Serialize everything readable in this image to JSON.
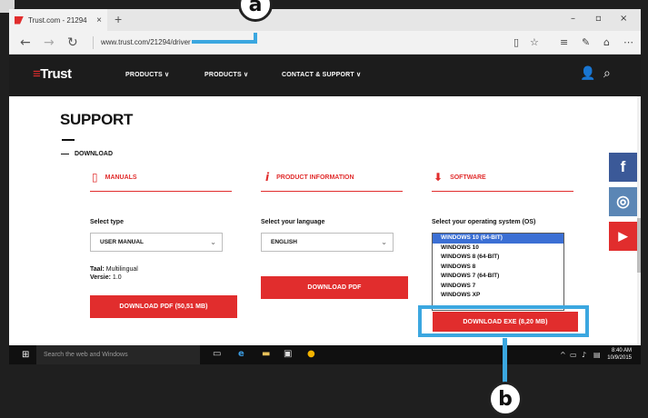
{
  "browser": {
    "tab_title": "Trust.com - 21294",
    "tab_close": "×",
    "new_tab": "+",
    "url": "www.trust.com/21294/driver",
    "win_min": "–",
    "win_max": "▫",
    "win_close": "×"
  },
  "site": {
    "logo_mark": "≡",
    "logo_text": "Trust",
    "nav": [
      "PRODUCTS ∨",
      "PRODUCTS ∨",
      "CONTACT & SUPPORT ∨"
    ]
  },
  "page": {
    "title": "SUPPORT",
    "breadcrumb": "DOWNLOAD",
    "manuals": {
      "heading": "MANUALS",
      "label": "Select type",
      "selected": "USER MANUAL",
      "lang_label": "Taal:",
      "lang_value": "Multilingual",
      "version_label": "Versie:",
      "version_value": "1.0",
      "button": "DOWNLOAD PDF (50,51 MB)"
    },
    "product_info": {
      "heading": "PRODUCT INFORMATION",
      "label": "Select your language",
      "selected": "ENGLISH",
      "button": "DOWNLOAD PDF"
    },
    "software": {
      "heading": "SOFTWARE",
      "label": "Select your operating system (OS)",
      "options": [
        "WINDOWS 10 (64-BIT)",
        "WINDOWS 10",
        "WINDOWS 8 (64-BIT)",
        "WINDOWS 8",
        "WINDOWS 7 (64-BIT)",
        "WINDOWS 7",
        "WINDOWS XP"
      ],
      "selected_index": 0,
      "button": "DOWNLOAD EXE (8,20 MB)"
    }
  },
  "social": {
    "facebook": "f",
    "instagram": "◎",
    "youtube": "▶",
    "colors": {
      "facebook": "#3b5998",
      "instagram": "#5b86b5",
      "youtube": "#e12d2d"
    }
  },
  "taskbar": {
    "search_placeholder": "Search the web and Windows",
    "time": "8:40 AM",
    "date": "10/9/2015"
  },
  "callouts": {
    "a": "a",
    "b": "b"
  },
  "colors": {
    "accent": "#e12d2d",
    "callout": "#3ba7e0",
    "header": "#1c1c1c"
  }
}
